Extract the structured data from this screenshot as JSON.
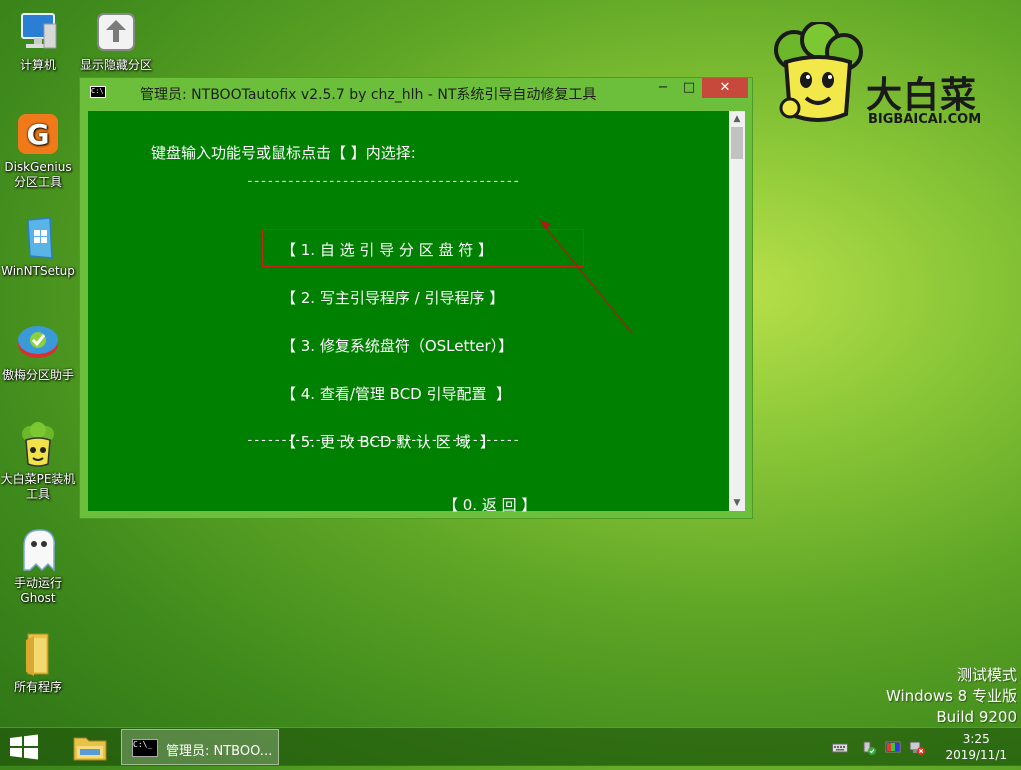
{
  "desktop": {
    "icons": [
      {
        "label": "计算机",
        "name": "computer-icon"
      },
      {
        "label": "显示隐藏分区",
        "name": "partition-toggle-icon"
      },
      {
        "label": "DiskGenius\n分区工具",
        "name": "diskgenius-icon"
      },
      {
        "label": "WinNTSetup",
        "name": "winntsetup-icon"
      },
      {
        "label": "傲梅分区助手",
        "name": "aomei-partition-icon"
      },
      {
        "label": "大白菜PE装机\n工具",
        "name": "dabaicai-installer-icon"
      },
      {
        "label": "手动运行\nGhost",
        "name": "ghost-icon"
      },
      {
        "label": "所有程序",
        "name": "all-programs-folder-icon"
      }
    ]
  },
  "logo": {
    "brand": "大白菜",
    "url": "BIGBAICAI.COM"
  },
  "window": {
    "title": "管理员:  NTBOOTautofix v2.5.7 by chz_hlh - NT系统引导自动修复工具",
    "minimize": "−",
    "maximize": "□",
    "close": "✕",
    "prompt": "键盘输入功能号或鼠标点击【 】内选择:",
    "separator": "----------------------------------------",
    "menu": [
      "【 1. 自 选 引 导 分 区 盘 符 】",
      "【 2. 写主引导程序 / 引导程序 】",
      "【 3. 修复系统盘符（OSLetter）】",
      "【 4. 查看/管理 BCD 引导配置  】",
      "【 5. 更 改 BCD 默 认 区 域  】"
    ],
    "back": "【 0. 返 回 】"
  },
  "taskbar": {
    "task_label": "管理员:  NTBOO...",
    "time": "3:25",
    "date": "2019/11/1"
  },
  "watermark": {
    "line1": "测试模式",
    "line2": "Windows 8 专业版",
    "line3": "Build 9200"
  },
  "colors": {
    "console_bg": "#008000",
    "highlight_border": "#cc2020",
    "close_button": "#c7493c"
  }
}
